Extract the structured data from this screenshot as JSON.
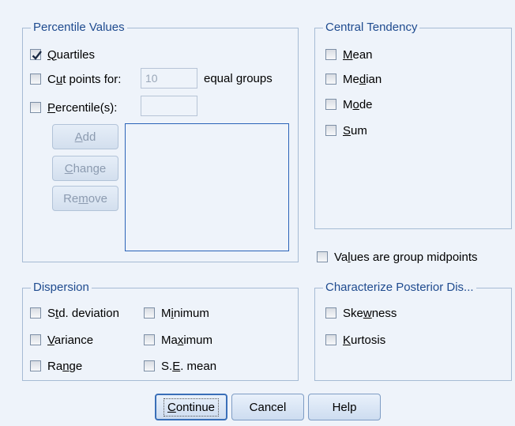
{
  "percentile_values": {
    "legend": "Percentile Values",
    "quartiles": {
      "pre": "",
      "ul": "Q",
      "post": "uartiles",
      "checked": true
    },
    "cut_points": {
      "pre": "C",
      "ul": "u",
      "post": "t points for:",
      "checked": false
    },
    "cut_points_value": "10",
    "equal_groups_label": "equal groups",
    "percentiles": {
      "pre": "",
      "ul": "P",
      "post": "ercentile(s):",
      "checked": false
    },
    "percentile_value": "",
    "add_button": {
      "pre": "",
      "ul": "A",
      "post": "dd"
    },
    "change_button": {
      "pre": "",
      "ul": "C",
      "post": "hange"
    },
    "remove_button": {
      "pre": "Re",
      "ul": "m",
      "post": "ove"
    }
  },
  "central_tendency": {
    "legend": "Central Tendency",
    "mean": {
      "pre": "",
      "ul": "M",
      "post": "ean",
      "checked": false
    },
    "median": {
      "pre": "Me",
      "ul": "d",
      "post": "ian",
      "checked": false
    },
    "mode": {
      "pre": "M",
      "ul": "o",
      "post": "de",
      "checked": false
    },
    "sum": {
      "pre": "",
      "ul": "S",
      "post": "um",
      "checked": false
    }
  },
  "group_midpoints": {
    "pre": "Va",
    "ul": "l",
    "post": "ues are group midpoints",
    "checked": false
  },
  "dispersion": {
    "legend": "Dispersion",
    "std_deviation": {
      "pre": "S",
      "ul": "t",
      "post": "d. deviation",
      "checked": false
    },
    "minimum": {
      "pre": "M",
      "ul": "i",
      "post": "nimum",
      "checked": false
    },
    "variance": {
      "pre": "",
      "ul": "V",
      "post": "ariance",
      "checked": false
    },
    "maximum": {
      "pre": "Ma",
      "ul": "x",
      "post": "imum",
      "checked": false
    },
    "range": {
      "pre": "Ra",
      "ul": "n",
      "post": "ge",
      "checked": false
    },
    "se_mean": {
      "pre": "S.",
      "ul": "E",
      "post": ". mean",
      "checked": false
    }
  },
  "posterior": {
    "legend": "Characterize Posterior Dis...",
    "skewness": {
      "pre": "Ske",
      "ul": "w",
      "post": "ness",
      "checked": false
    },
    "kurtosis": {
      "pre": "",
      "ul": "K",
      "post": "urtosis",
      "checked": false
    }
  },
  "footer": {
    "continue": {
      "pre": "",
      "ul": "C",
      "post": "ontinue"
    },
    "cancel": "Cancel",
    "help": "Help"
  },
  "colors": {
    "background": "#eef3fa",
    "legend_text": "#1f4b8f",
    "group_border": "#a6bbd4",
    "disabled_text": "#8c9bb0"
  }
}
